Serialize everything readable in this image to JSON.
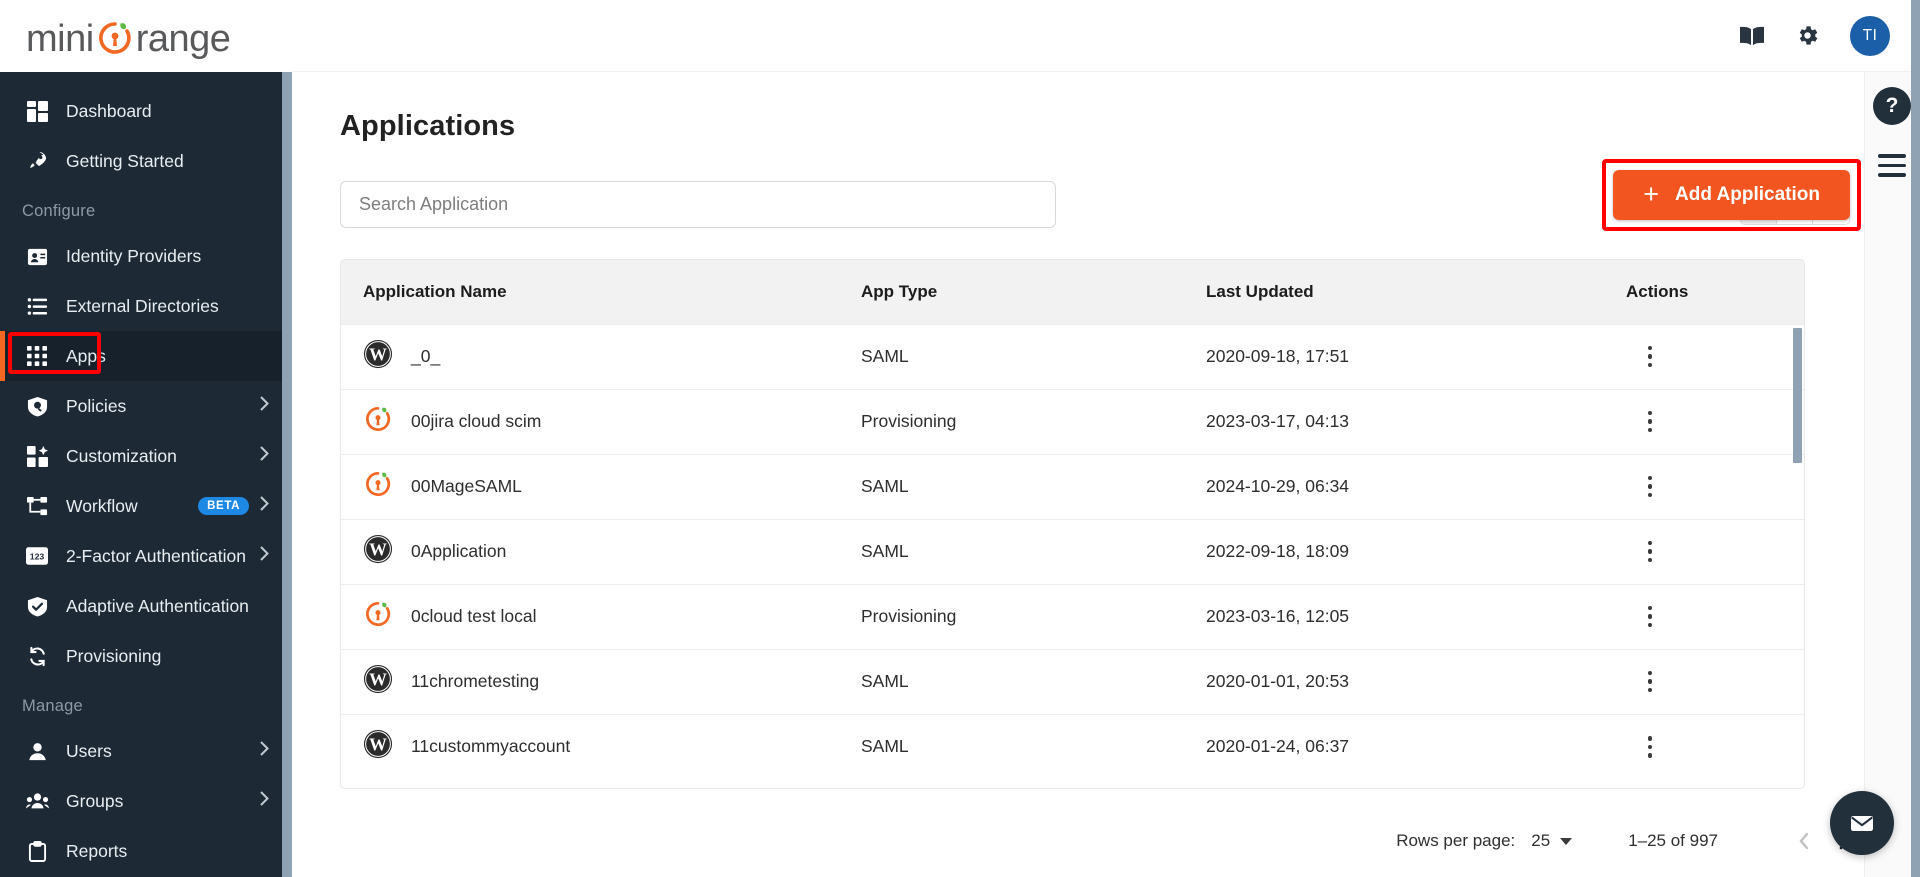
{
  "brand": {
    "name_part1": "mini",
    "name_part2": "range",
    "accent": "#f26722",
    "logo_icon": "miniorange-keyhole-logo"
  },
  "topbar": {
    "book_icon": "book-icon",
    "gear_icon": "gear-icon",
    "avatar_initials": "TI",
    "avatar_color": "#1a5fa8"
  },
  "sidebar": {
    "items": [
      {
        "label": "Dashboard",
        "icon": "dashboard-icon",
        "section": null,
        "active": false,
        "expandable": false
      },
      {
        "label": "Getting Started",
        "icon": "rocket-icon",
        "section": null,
        "active": false,
        "expandable": false
      },
      {
        "label": "Configure",
        "type": "section"
      },
      {
        "label": "Identity Providers",
        "icon": "id-card-icon",
        "active": false,
        "expandable": false
      },
      {
        "label": "External Directories",
        "icon": "list-icon",
        "active": false,
        "expandable": false
      },
      {
        "label": "Apps",
        "icon": "grid-apps-icon",
        "active": true,
        "expandable": false
      },
      {
        "label": "Policies",
        "icon": "shield-search-icon",
        "active": false,
        "expandable": true
      },
      {
        "label": "Customization",
        "icon": "customization-icon",
        "active": false,
        "expandable": true
      },
      {
        "label": "Workflow",
        "icon": "workflow-icon",
        "active": false,
        "expandable": true,
        "badge": "BETA"
      },
      {
        "label": "2-Factor Authentication",
        "icon": "numeric-123-icon",
        "active": false,
        "expandable": true
      },
      {
        "label": "Adaptive Authentication",
        "icon": "shield-check-icon",
        "active": false,
        "expandable": false
      },
      {
        "label": "Provisioning",
        "icon": "sync-icon",
        "active": false,
        "expandable": false
      },
      {
        "label": "Manage",
        "type": "section"
      },
      {
        "label": "Users",
        "icon": "user-icon",
        "active": false,
        "expandable": true
      },
      {
        "label": "Groups",
        "icon": "group-icon",
        "active": false,
        "expandable": true
      },
      {
        "label": "Reports",
        "icon": "clipboard-icon",
        "active": false,
        "expandable": false
      }
    ]
  },
  "main": {
    "page_title": "Applications",
    "search": {
      "placeholder": "Search Application",
      "value": ""
    },
    "add_button": {
      "label": "Add Application",
      "icon": "plus-icon",
      "color": "#f2551f"
    },
    "view_toggles": [
      {
        "name": "column-view",
        "icon": "column-view-icon",
        "selected": true
      },
      {
        "name": "list-view",
        "icon": "list-view-icon",
        "selected": false
      },
      {
        "name": "grid-view",
        "icon": "grid-view-icon",
        "selected": false
      }
    ],
    "table": {
      "columns": [
        "Application Name",
        "App Type",
        "Last Updated",
        "Actions"
      ],
      "rows": [
        {
          "icon": "wordpress-icon",
          "name": "_0_",
          "type": "SAML",
          "updated": "2020-09-18, 17:51"
        },
        {
          "icon": "miniorange-icon",
          "name": "00jira cloud scim",
          "type": "Provisioning",
          "updated": "2023-03-17, 04:13"
        },
        {
          "icon": "miniorange-icon",
          "name": "00MageSAML",
          "type": "SAML",
          "updated": "2024-10-29, 06:34"
        },
        {
          "icon": "wordpress-icon",
          "name": "0Application",
          "type": "SAML",
          "updated": "2022-09-18, 18:09"
        },
        {
          "icon": "miniorange-icon",
          "name": "0cloud test local",
          "type": "Provisioning",
          "updated": "2023-03-16, 12:05"
        },
        {
          "icon": "wordpress-icon",
          "name": "11chrometesting",
          "type": "SAML",
          "updated": "2020-01-01, 20:53"
        },
        {
          "icon": "wordpress-icon",
          "name": "11custommyaccount",
          "type": "SAML",
          "updated": "2020-01-24, 06:37"
        }
      ],
      "row_action_icon": "kebab-menu-icon"
    },
    "pagination": {
      "rows_per_page_label": "Rows per page:",
      "rows_per_page_value": "25",
      "range": "1–25 of 997",
      "prev_icon": "chevron-left-icon",
      "next_icon": "chevron-right-icon",
      "prev_enabled": false,
      "next_enabled": true
    }
  },
  "rail": {
    "help_label": "?",
    "help_icon": "question-mark-icon",
    "menu_icon": "hamburger-menu-icon",
    "mail_icon": "envelope-icon"
  },
  "annotations": {
    "boxes": [
      {
        "target": "sidebar-item-apps",
        "color": "#fe0000"
      },
      {
        "target": "add-application-button",
        "color": "#fe0000"
      }
    ]
  }
}
